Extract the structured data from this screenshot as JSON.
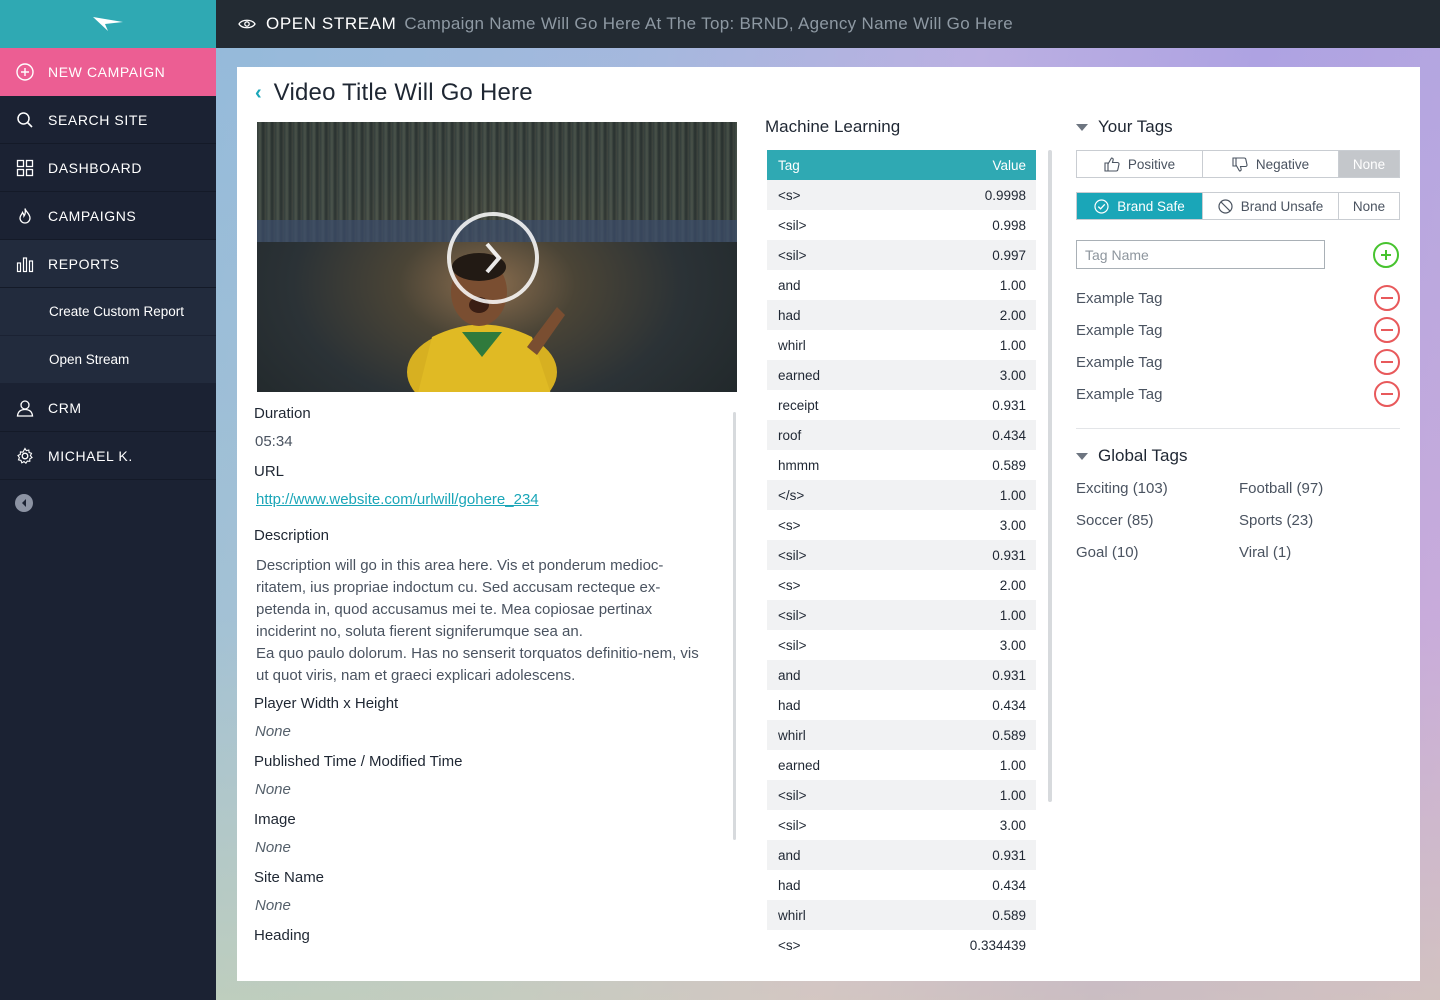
{
  "sidebar": {
    "new_campaign": "NEW CAMPAIGN",
    "items": [
      {
        "label": "SEARCH SITE"
      },
      {
        "label": "DASHBOARD"
      },
      {
        "label": "CAMPAIGNS"
      },
      {
        "label": "REPORTS"
      },
      {
        "label": "CRM"
      },
      {
        "label": "MICHAEL K."
      }
    ],
    "sub_items": [
      {
        "label": "Create Custom Report"
      },
      {
        "label": "Open Stream"
      }
    ]
  },
  "topbar": {
    "page": "OPEN STREAM",
    "crumb": "Campaign Name Will Go Here At The Top: BRND, Agency Name Will Go Here"
  },
  "video": {
    "title": "Video Title Will Go Here"
  },
  "details": {
    "duration_label": "Duration",
    "duration_value": "05:34",
    "url_label": "URL",
    "url_value": "http://www.website.com/urlwill/gohere_234",
    "description_label": "Description",
    "description_p1": "Description will go in this area here. Vis et ponderum medioc-ritatem, ius propriae indoctum cu. Sed accusam recteque ex-petenda in, quod accusamus mei te. Mea copiosae pertinax inciderint no, soluta fierent signiferumque sea an.",
    "description_p2": "Ea quo paulo dolorum. Has no senserit torquatos definitio-nem, vis ut quot viris, nam et graeci explicari adolescens.",
    "player_label": "Player Width x Height",
    "player_value": "None",
    "published_label": "Published Time / Modified Time",
    "published_value": "None",
    "image_label": "Image",
    "image_value": "None",
    "site_label": "Site Name",
    "site_value": "None",
    "heading_label": "Heading"
  },
  "ml": {
    "title": "Machine Learning",
    "col_tag": "Tag",
    "col_value": "Value",
    "rows": [
      [
        "<s>",
        "0.9998"
      ],
      [
        "<sil>",
        "0.998"
      ],
      [
        "<sil>",
        "0.997"
      ],
      [
        "and",
        "1.00"
      ],
      [
        "had",
        "2.00"
      ],
      [
        "whirl",
        "1.00"
      ],
      [
        "earned",
        "3.00"
      ],
      [
        "receipt",
        "0.931"
      ],
      [
        "roof",
        "0.434"
      ],
      [
        "hmmm",
        "0.589"
      ],
      [
        "</s>",
        "1.00"
      ],
      [
        "<s>",
        "3.00"
      ],
      [
        "<sil>",
        "0.931"
      ],
      [
        "<s>",
        "2.00"
      ],
      [
        "<sil>",
        "1.00"
      ],
      [
        "<sil>",
        "3.00"
      ],
      [
        "and",
        "0.931"
      ],
      [
        "had",
        "0.434"
      ],
      [
        "whirl",
        "0.589"
      ],
      [
        "earned",
        "1.00"
      ],
      [
        "<sil>",
        "1.00"
      ],
      [
        "<sil>",
        "3.00"
      ],
      [
        "and",
        "0.931"
      ],
      [
        "had",
        "0.434"
      ],
      [
        "whirl",
        "0.589"
      ],
      [
        "<s>",
        "0.334439"
      ]
    ]
  },
  "your_tags": {
    "title": "Your Tags",
    "sentiment": {
      "positive": "Positive",
      "negative": "Negative",
      "none": "None",
      "selected": "None"
    },
    "safety": {
      "safe": "Brand Safe",
      "unsafe": "Brand Unsafe",
      "none": "None",
      "selected": "Brand Safe"
    },
    "input_placeholder": "Tag Name",
    "tags": [
      "Example Tag",
      "Example Tag",
      "Example Tag",
      "Example Tag"
    ]
  },
  "global_tags": {
    "title": "Global Tags",
    "tags": [
      "Exciting (103)",
      "Football (97)",
      "Soccer (85)",
      "Sports (23)",
      "Goal (10)",
      "Viral (1)"
    ]
  },
  "colors": {
    "accent_teal": "#2fa9b3",
    "brand_pink": "#ec5e93",
    "sidebar_bg": "#1b2233",
    "add_green": "#47c32f",
    "remove_red": "#e8595b"
  }
}
